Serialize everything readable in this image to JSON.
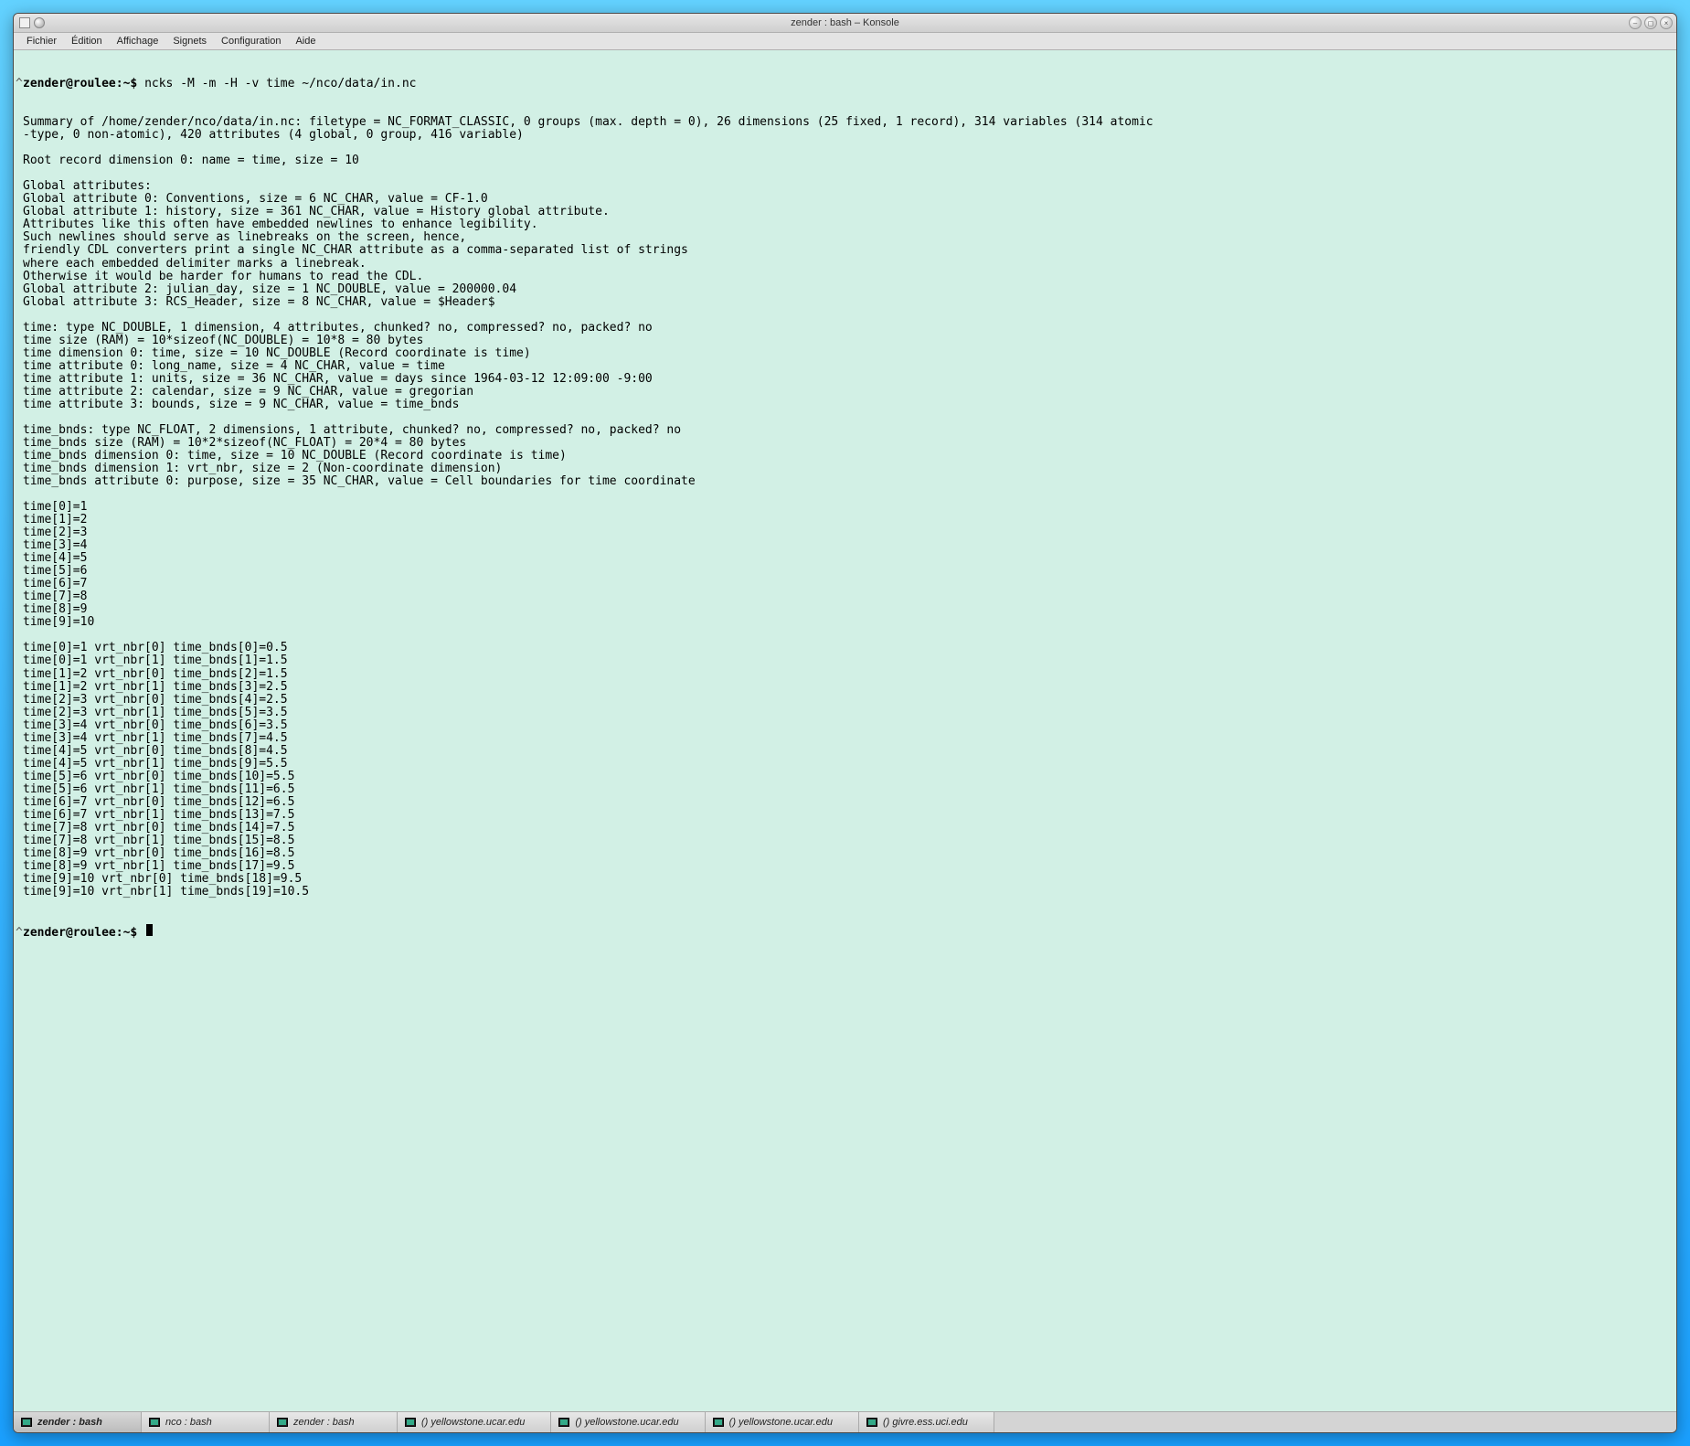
{
  "window": {
    "title": "zender : bash – Konsole"
  },
  "menu": {
    "items": [
      "Fichier",
      "Édition",
      "Affichage",
      "Signets",
      "Configuration",
      "Aide"
    ]
  },
  "prompt": {
    "text": "zender@roulee:~$ ",
    "command": "ncks -M -m -H -v time ~/nco/data/in.nc"
  },
  "output_lines": [
    "Summary of /home/zender/nco/data/in.nc: filetype = NC_FORMAT_CLASSIC, 0 groups (max. depth = 0), 26 dimensions (25 fixed, 1 record), 314 variables (314 atomic",
    "-type, 0 non-atomic), 420 attributes (4 global, 0 group, 416 variable)",
    "",
    "Root record dimension 0: name = time, size = 10",
    "",
    "Global attributes:",
    "Global attribute 0: Conventions, size = 6 NC_CHAR, value = CF-1.0",
    "Global attribute 1: history, size = 361 NC_CHAR, value = History global attribute.",
    "Attributes like this often have embedded newlines to enhance legibility.",
    "Such newlines should serve as linebreaks on the screen, hence,",
    "friendly CDL converters print a single NC_CHAR attribute as a comma-separated list of strings",
    "where each embedded delimiter marks a linebreak.",
    "Otherwise it would be harder for humans to read the CDL.",
    "Global attribute 2: julian_day, size = 1 NC_DOUBLE, value = 200000.04",
    "Global attribute 3: RCS_Header, size = 8 NC_CHAR, value = $Header$",
    "",
    "time: type NC_DOUBLE, 1 dimension, 4 attributes, chunked? no, compressed? no, packed? no",
    "time size (RAM) = 10*sizeof(NC_DOUBLE) = 10*8 = 80 bytes",
    "time dimension 0: time, size = 10 NC_DOUBLE (Record coordinate is time)",
    "time attribute 0: long_name, size = 4 NC_CHAR, value = time",
    "time attribute 1: units, size = 36 NC_CHAR, value = days since 1964-03-12 12:09:00 -9:00",
    "time attribute 2: calendar, size = 9 NC_CHAR, value = gregorian",
    "time attribute 3: bounds, size = 9 NC_CHAR, value = time_bnds",
    "",
    "time_bnds: type NC_FLOAT, 2 dimensions, 1 attribute, chunked? no, compressed? no, packed? no",
    "time_bnds size (RAM) = 10*2*sizeof(NC_FLOAT) = 20*4 = 80 bytes",
    "time_bnds dimension 0: time, size = 10 NC_DOUBLE (Record coordinate is time)",
    "time_bnds dimension 1: vrt_nbr, size = 2 (Non-coordinate dimension)",
    "time_bnds attribute 0: purpose, size = 35 NC_CHAR, value = Cell boundaries for time coordinate",
    "",
    "time[0]=1",
    "time[1]=2",
    "time[2]=3",
    "time[3]=4",
    "time[4]=5",
    "time[5]=6",
    "time[6]=7",
    "time[7]=8",
    "time[8]=9",
    "time[9]=10",
    "",
    "time[0]=1 vrt_nbr[0] time_bnds[0]=0.5",
    "time[0]=1 vrt_nbr[1] time_bnds[1]=1.5",
    "time[1]=2 vrt_nbr[0] time_bnds[2]=1.5",
    "time[1]=2 vrt_nbr[1] time_bnds[3]=2.5",
    "time[2]=3 vrt_nbr[0] time_bnds[4]=2.5",
    "time[2]=3 vrt_nbr[1] time_bnds[5]=3.5",
    "time[3]=4 vrt_nbr[0] time_bnds[6]=3.5",
    "time[3]=4 vrt_nbr[1] time_bnds[7]=4.5",
    "time[4]=5 vrt_nbr[0] time_bnds[8]=4.5",
    "time[4]=5 vrt_nbr[1] time_bnds[9]=5.5",
    "time[5]=6 vrt_nbr[0] time_bnds[10]=5.5",
    "time[5]=6 vrt_nbr[1] time_bnds[11]=6.5",
    "time[6]=7 vrt_nbr[0] time_bnds[12]=6.5",
    "time[6]=7 vrt_nbr[1] time_bnds[13]=7.5",
    "time[7]=8 vrt_nbr[0] time_bnds[14]=7.5",
    "time[7]=8 vrt_nbr[1] time_bnds[15]=8.5",
    "time[8]=9 vrt_nbr[0] time_bnds[16]=8.5",
    "time[8]=9 vrt_nbr[1] time_bnds[17]=9.5",
    "time[9]=10 vrt_nbr[0] time_bnds[18]=9.5",
    "time[9]=10 vrt_nbr[1] time_bnds[19]=10.5",
    ""
  ],
  "prompt2": "zender@roulee:~$ ",
  "tabs": [
    {
      "label": "zender : bash",
      "active": true
    },
    {
      "label": "nco : bash",
      "active": false
    },
    {
      "label": "zender : bash",
      "active": false
    },
    {
      "label": "() yellowstone.ucar.edu",
      "active": false
    },
    {
      "label": "() yellowstone.ucar.edu",
      "active": false
    },
    {
      "label": "() yellowstone.ucar.edu",
      "active": false
    },
    {
      "label": "() givre.ess.uci.edu",
      "active": false
    }
  ]
}
